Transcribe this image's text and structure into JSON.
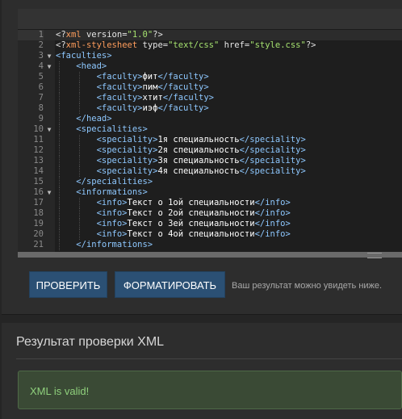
{
  "editor": {
    "lines": [
      {
        "n": "1",
        "fold": "",
        "indent": 0,
        "active": true,
        "parts": [
          [
            "pi",
            "<?"
          ],
          [
            "pi-name",
            "xml"
          ],
          [
            "attr",
            " version="
          ],
          [
            "str",
            "\"1.0\""
          ],
          [
            "pi",
            "?>"
          ]
        ]
      },
      {
        "n": "2",
        "fold": "",
        "indent": 0,
        "parts": [
          [
            "pi",
            "<?"
          ],
          [
            "pi-name",
            "xml-stylesheet"
          ],
          [
            "attr",
            " type="
          ],
          [
            "str",
            "\"text/css\""
          ],
          [
            "attr",
            " href="
          ],
          [
            "str",
            "\"style.css\""
          ],
          [
            "pi",
            "?>"
          ]
        ]
      },
      {
        "n": "3",
        "fold": "▼",
        "indent": 0,
        "parts": [
          [
            "tag",
            "<faculties>"
          ]
        ]
      },
      {
        "n": "4",
        "fold": "▼",
        "indent": 1,
        "parts": [
          [
            "tag",
            "<head>"
          ]
        ]
      },
      {
        "n": "5",
        "fold": "",
        "indent": 2,
        "parts": [
          [
            "tag",
            "<faculty>"
          ],
          [
            "txt",
            "фит"
          ],
          [
            "tag",
            "</faculty>"
          ]
        ]
      },
      {
        "n": "6",
        "fold": "",
        "indent": 2,
        "parts": [
          [
            "tag",
            "<faculty>"
          ],
          [
            "txt",
            "пим"
          ],
          [
            "tag",
            "</faculty>"
          ]
        ]
      },
      {
        "n": "7",
        "fold": "",
        "indent": 2,
        "parts": [
          [
            "tag",
            "<faculty>"
          ],
          [
            "txt",
            "хтит"
          ],
          [
            "tag",
            "</faculty>"
          ]
        ]
      },
      {
        "n": "8",
        "fold": "",
        "indent": 2,
        "parts": [
          [
            "tag",
            "<faculty>"
          ],
          [
            "txt",
            "иэф"
          ],
          [
            "tag",
            "</faculty>"
          ]
        ]
      },
      {
        "n": "9",
        "fold": "",
        "indent": 1,
        "parts": [
          [
            "tag",
            "</head>"
          ]
        ]
      },
      {
        "n": "10",
        "fold": "▼",
        "indent": 1,
        "parts": [
          [
            "tag",
            "<specialities>"
          ]
        ]
      },
      {
        "n": "11",
        "fold": "",
        "indent": 2,
        "parts": [
          [
            "tag",
            "<speciality>"
          ],
          [
            "txt",
            "1я специальность"
          ],
          [
            "tag",
            "</speciality>"
          ]
        ]
      },
      {
        "n": "12",
        "fold": "",
        "indent": 2,
        "parts": [
          [
            "tag",
            "<speciality>"
          ],
          [
            "txt",
            "2я специальность"
          ],
          [
            "tag",
            "</speciality>"
          ]
        ]
      },
      {
        "n": "13",
        "fold": "",
        "indent": 2,
        "parts": [
          [
            "tag",
            "<speciality>"
          ],
          [
            "txt",
            "3я специальность"
          ],
          [
            "tag",
            "</speciality>"
          ]
        ]
      },
      {
        "n": "14",
        "fold": "",
        "indent": 2,
        "parts": [
          [
            "tag",
            "<speciality>"
          ],
          [
            "txt",
            "4я специальность"
          ],
          [
            "tag",
            "</speciality>"
          ]
        ]
      },
      {
        "n": "15",
        "fold": "",
        "indent": 1,
        "parts": [
          [
            "tag",
            "</specialities>"
          ]
        ]
      },
      {
        "n": "16",
        "fold": "▼",
        "indent": 1,
        "parts": [
          [
            "tag",
            "<informations>"
          ]
        ]
      },
      {
        "n": "17",
        "fold": "",
        "indent": 2,
        "parts": [
          [
            "tag",
            "<info>"
          ],
          [
            "txt",
            "Текст о 1ой специальности"
          ],
          [
            "tag",
            "</info>"
          ]
        ]
      },
      {
        "n": "18",
        "fold": "",
        "indent": 2,
        "parts": [
          [
            "tag",
            "<info>"
          ],
          [
            "txt",
            "Текст о 2ой специальности"
          ],
          [
            "tag",
            "</info>"
          ]
        ]
      },
      {
        "n": "19",
        "fold": "",
        "indent": 2,
        "parts": [
          [
            "tag",
            "<info>"
          ],
          [
            "txt",
            "Текст о 3ей специальности"
          ],
          [
            "tag",
            "</info>"
          ]
        ]
      },
      {
        "n": "20",
        "fold": "",
        "indent": 2,
        "parts": [
          [
            "tag",
            "<info>"
          ],
          [
            "txt",
            "Текст о 4ой специальности"
          ],
          [
            "tag",
            "</info>"
          ]
        ]
      },
      {
        "n": "21",
        "fold": "",
        "indent": 1,
        "parts": [
          [
            "tag",
            "</informations>"
          ]
        ]
      }
    ]
  },
  "actions": {
    "check_label": "ПРОВЕРИТЬ",
    "format_label": "ФОРМАТИРОВАТЬ",
    "hint": "Ваш результат можно увидеть ниже."
  },
  "result": {
    "title": "Результат проверки XML",
    "message": "XML is valid!"
  },
  "colors": {
    "button": "#2b5074",
    "success_text": "#8fd07c",
    "success_bg": "#3a4a35"
  }
}
